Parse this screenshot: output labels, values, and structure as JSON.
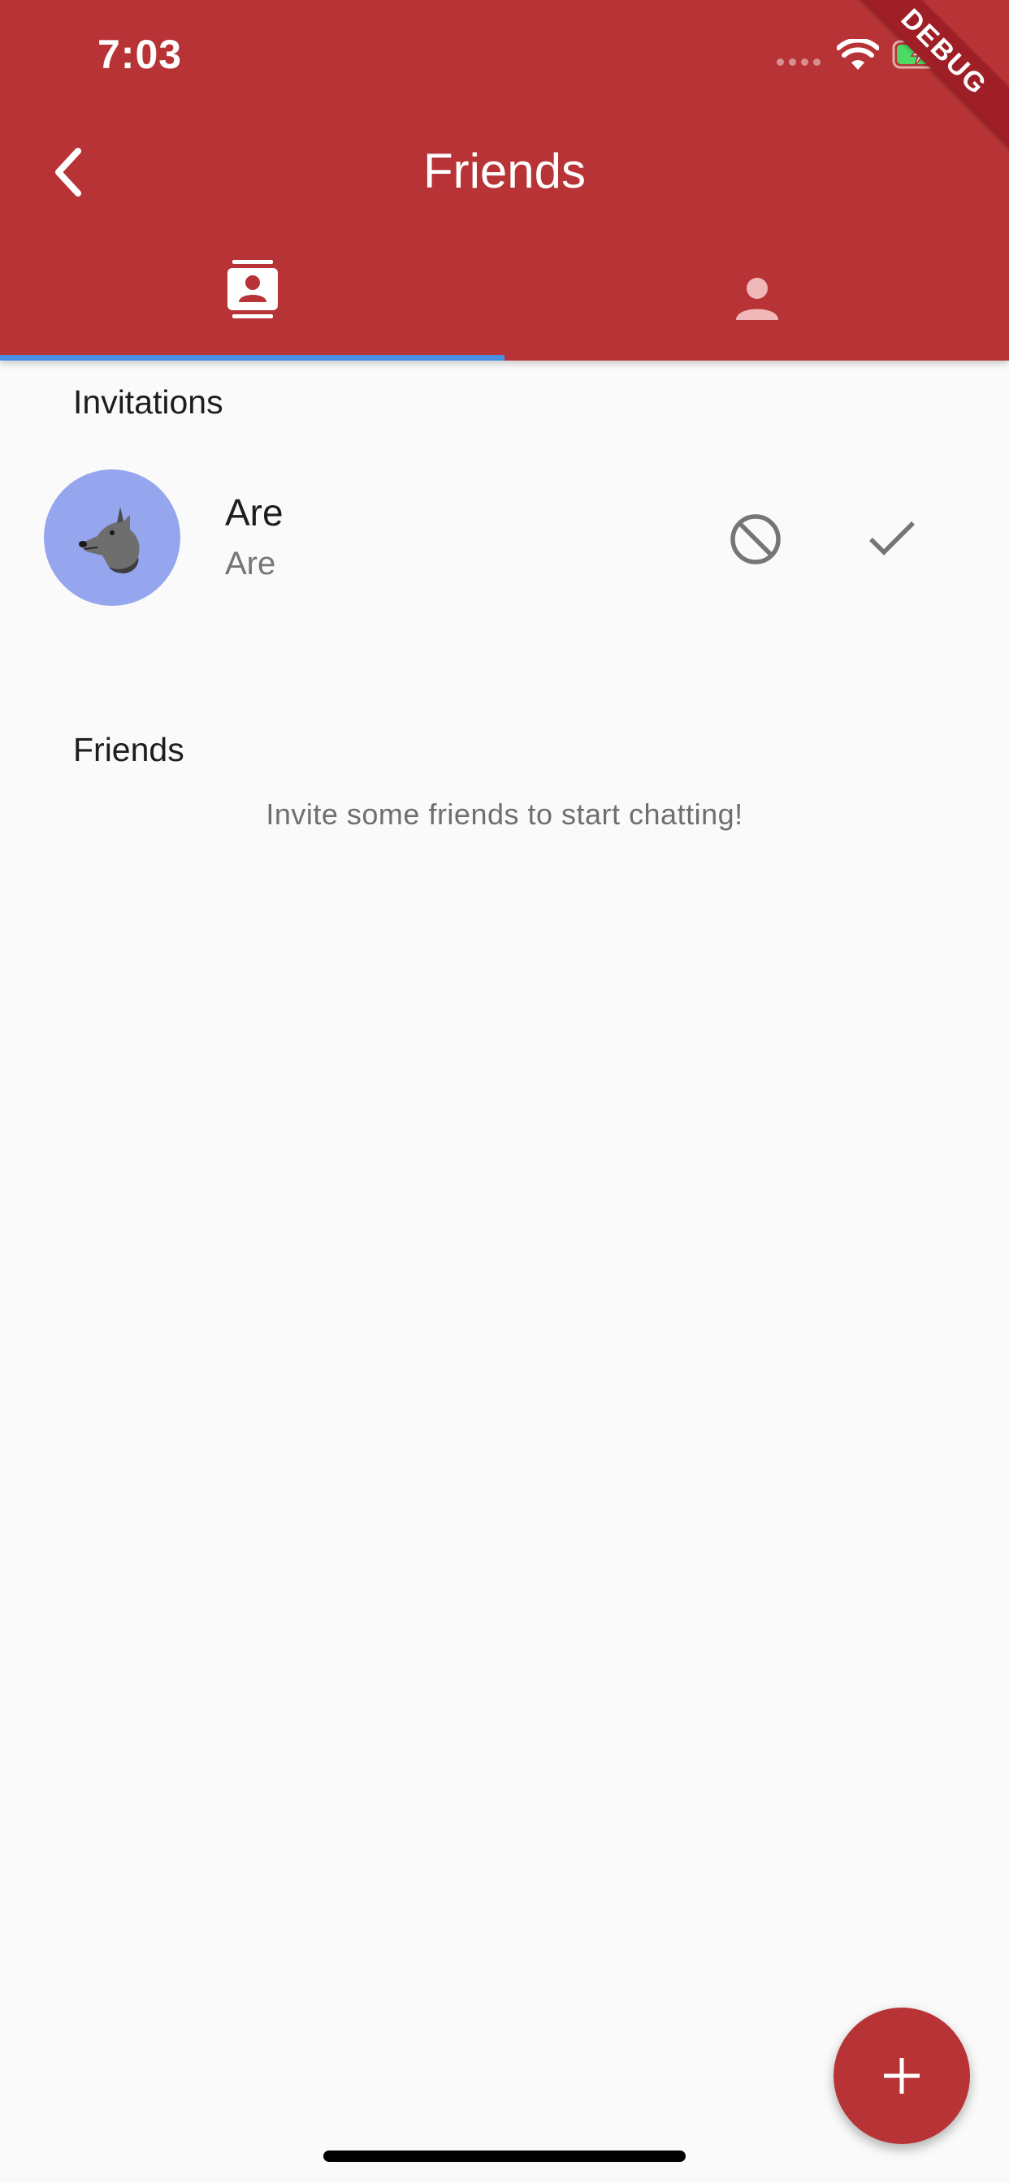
{
  "status_bar": {
    "time": "7:03"
  },
  "debug_banner": "DEBUG",
  "app_bar": {
    "title": "Friends",
    "background_color": "#b73335",
    "back_icon": "chevron-left-icon"
  },
  "tabs": [
    {
      "icon": "contacts-icon",
      "selected": true
    },
    {
      "icon": "person-icon",
      "selected": false
    }
  ],
  "tab_indicator_color": "#4a90e2",
  "invitations": {
    "header": "Invitations",
    "items": [
      {
        "name": "Are",
        "subtitle": "Are",
        "avatar_icon": "wolf-icon",
        "avatar_color": "#95a5ee",
        "decline_icon": "block-icon",
        "accept_icon": "check-icon"
      }
    ]
  },
  "friends": {
    "header": "Friends",
    "empty_message": "Invite some friends to start chatting!"
  },
  "fab": {
    "icon": "plus-icon",
    "color": "#b73335"
  }
}
